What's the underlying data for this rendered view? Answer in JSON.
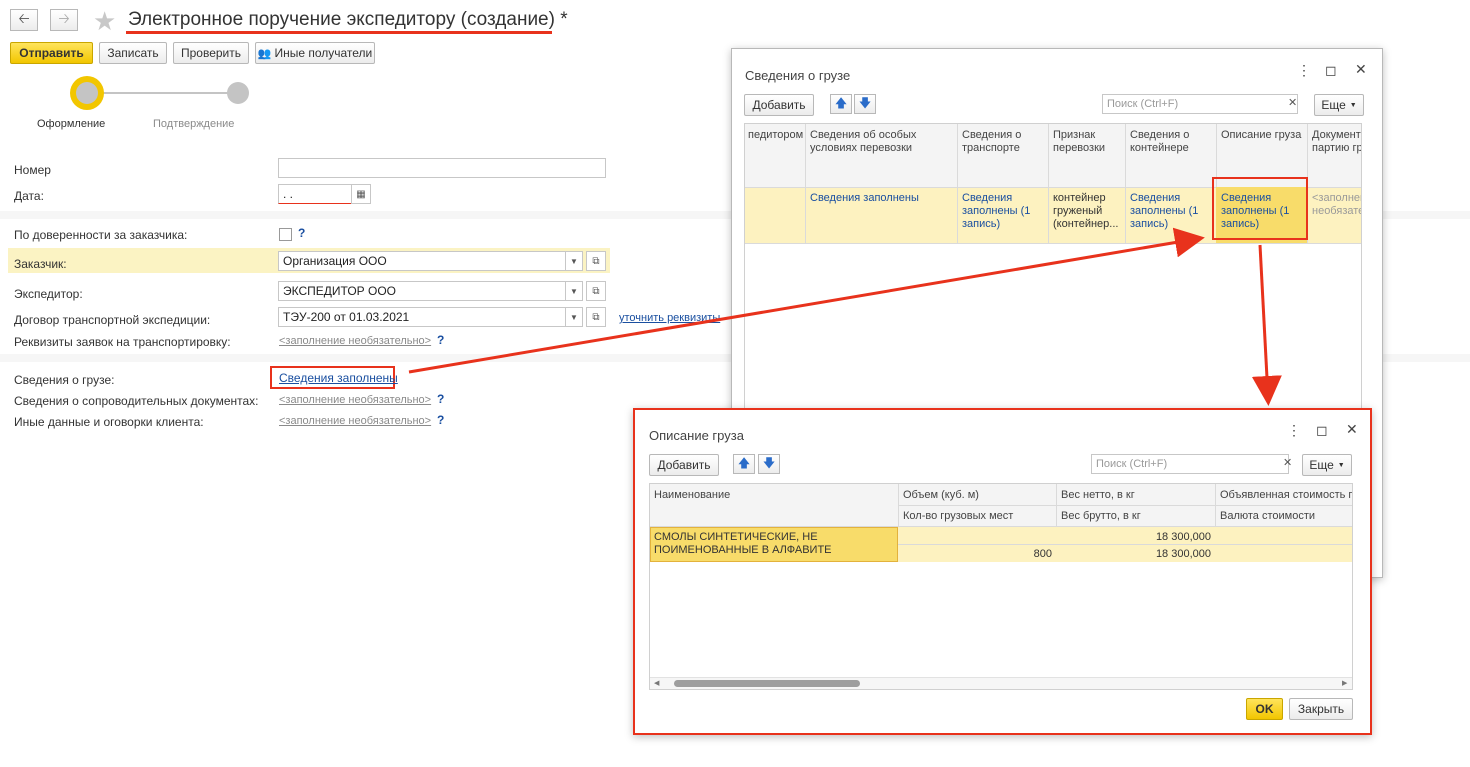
{
  "header": {
    "title": "Электронное поручение экспедитору (создание)",
    "modified_marker": "*",
    "back_icon": "arrow-left-icon",
    "forward_icon": "arrow-right-icon",
    "favorite_icon": "star-icon"
  },
  "toolbar": {
    "send_label": "Отправить",
    "save_label": "Записать",
    "check_label": "Проверить",
    "other_recipients_label": "Иные получатели"
  },
  "steps": [
    {
      "label": "Оформление"
    },
    {
      "label": "Подтверждение"
    }
  ],
  "form": {
    "number_label": "Номер",
    "number_value": "",
    "date_label": "Дата:",
    "date_value": ". .",
    "by_proxy_label": "По доверенности за заказчика:",
    "customer_label": "Заказчик:",
    "customer_value": "Организация ООО",
    "forwarder_label": "Экспедитор:",
    "forwarder_value": "ЭКСПЕДИТОР ООО",
    "contract_label": "Договор транспортной экспедиции:",
    "contract_value": "ТЭУ-200 от 01.03.2021",
    "clarify_link": "уточнить реквизиты",
    "requisites_label": "Реквизиты заявок на транспортировку:",
    "optional_text": "<заполнение необязательно>",
    "cargo_label": "Сведения о грузе:",
    "cargo_link": "Сведения заполнены",
    "docs_label": "Сведения о сопроводительных документах:",
    "other_label": "Иные данные и оговорки клиента:",
    "help": "?"
  },
  "cargo_dialog": {
    "title": "Сведения о грузе",
    "add_label": "Добавить",
    "search_placeholder": "Поиск (Ctrl+F)",
    "more_label": "Еще",
    "columns": [
      "педитором",
      "Сведения об особых условиях перевозки",
      "Сведения о транспорте",
      "Признак перевозки",
      "Сведения о контейнере",
      "Описание груза",
      "Документ партию гр"
    ],
    "row": {
      "special": "Сведения заполнены",
      "transport": "Сведения заполнены (1 запись)",
      "sign": "контейнер груженый (контейнер...",
      "container": "Сведения заполнены (1 запись)",
      "description": "Сведения заполнены (1 запись)",
      "doc": "<заполнен необязате"
    }
  },
  "desc_dialog": {
    "title": "Описание груза",
    "add_label": "Добавить",
    "search_placeholder": "Поиск (Ctrl+F)",
    "more_label": "Еще",
    "headers": {
      "name": "Наименование",
      "volume": "Объем (куб. м)",
      "places": "Кол-во грузовых мест",
      "net": "Вес нетто, в кг",
      "gross": "Вес брутто, в кг",
      "declared": "Объявленная стоимость г",
      "currency": "Валюта стоимости"
    },
    "row": {
      "name": "СМОЛЫ СИНТЕТИЧЕСКИЕ, НЕ ПОИМЕНОВАННЫЕ В АЛФАВИТЕ",
      "places": "800",
      "net": "18 300,000",
      "gross": "18 300,000"
    },
    "ok_label": "OK",
    "close_label": "Закрыть"
  },
  "colors": {
    "accent_yellow": "#f2c600",
    "highlight_red": "#e8321c",
    "row_yellow": "#fdf2c0"
  }
}
